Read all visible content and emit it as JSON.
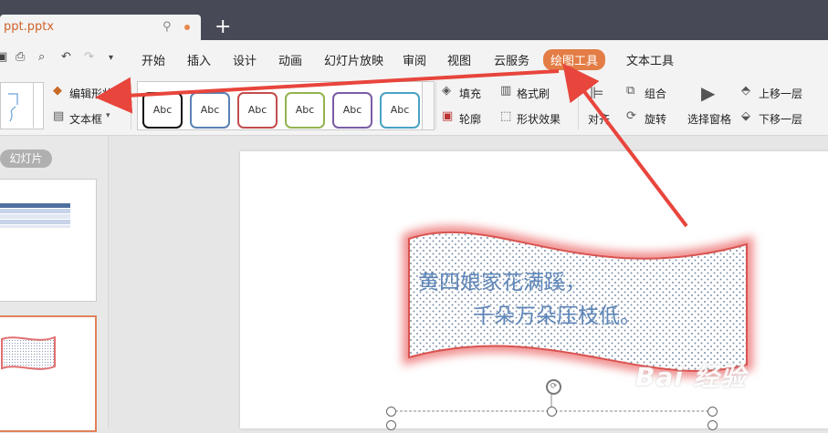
{
  "titlebar": {
    "doc_name": "ppt.pptx",
    "new_tab": "+"
  },
  "menu": {
    "items": [
      "开始",
      "插入",
      "设计",
      "动画",
      "幻灯片放映",
      "审阅",
      "视图",
      "云服务",
      "绘图工具",
      "文本工具"
    ],
    "active": "绘图工具"
  },
  "ribbon": {
    "edit_shape": "编辑形状",
    "text_box": "文本框",
    "style_label": "Abc",
    "fill": "填充",
    "outline": "轮廓",
    "format_painter": "格式刷",
    "shape_effects": "形状效果",
    "align": "对齐",
    "group": "组合",
    "rotate": "旋转",
    "selection_pane": "选择窗格",
    "bring_forward": "上移一层",
    "send_backward": "下移一层"
  },
  "panel": {
    "tab": "幻灯片"
  },
  "slide": {
    "line1": "黄四娘家花满蹊，",
    "line2": "千朵万朵压枝低。",
    "watermark": "Bai 经验"
  },
  "colors": {
    "accent": "#e37d45",
    "arrow": "#e8453c",
    "text_blue": "#5e86b8",
    "glow": "#f08a8a"
  },
  "icons": [
    "pin-icon",
    "save-icon",
    "print-icon",
    "preview-icon",
    "undo-icon",
    "redo-icon",
    "dropdown-icon",
    "rotate-handle-icon"
  ]
}
